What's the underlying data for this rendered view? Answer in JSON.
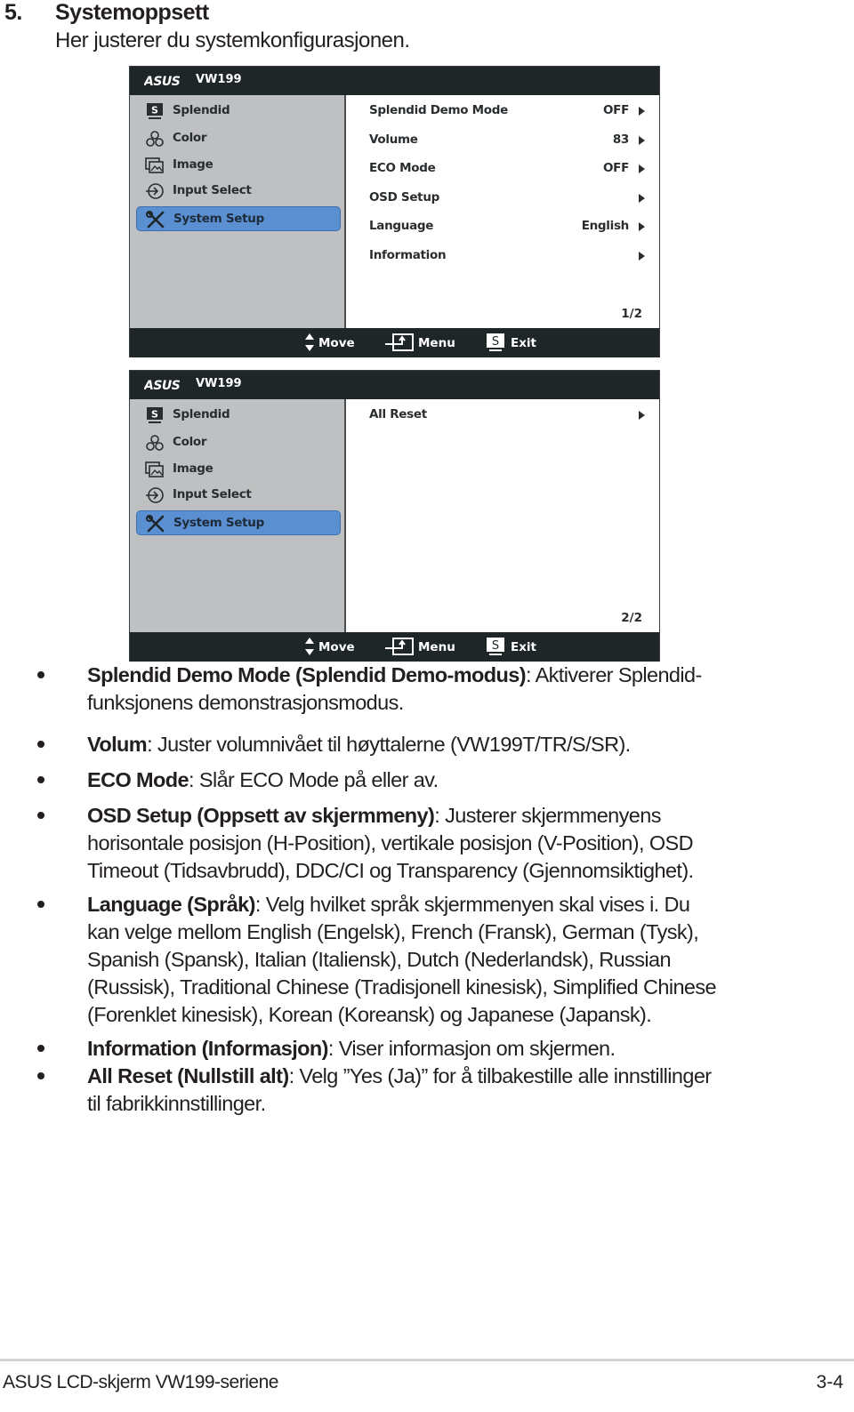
{
  "section": {
    "number": "5.",
    "title": "Systemoppsett",
    "subtitle": "Her justerer du systemkonfigurasjonen."
  },
  "osd_panels": [
    {
      "brand": "ASUS",
      "model": "VW199",
      "sidebar": [
        {
          "label": "Splendid",
          "icon": "splendid-icon",
          "active": false
        },
        {
          "label": "Color",
          "icon": "color-icon",
          "active": false
        },
        {
          "label": "Image",
          "icon": "image-icon",
          "active": false
        },
        {
          "label": "Input Select",
          "icon": "input-select-icon",
          "active": false
        },
        {
          "label": "System Setup",
          "icon": "system-setup-icon",
          "active": true
        }
      ],
      "items": [
        {
          "label": "Splendid Demo Mode",
          "value": "OFF"
        },
        {
          "label": "Volume",
          "value": "83"
        },
        {
          "label": "ECO Mode",
          "value": "OFF"
        },
        {
          "label": "OSD Setup",
          "value": ""
        },
        {
          "label": "Language",
          "value": "English"
        },
        {
          "label": "Information",
          "value": ""
        }
      ],
      "page": "1/2",
      "footer": {
        "move": "Move",
        "menu": "Menu",
        "exit": "Exit"
      }
    },
    {
      "brand": "ASUS",
      "model": "VW199",
      "sidebar": [
        {
          "label": "Splendid",
          "icon": "splendid-icon",
          "active": false
        },
        {
          "label": "Color",
          "icon": "color-icon",
          "active": false
        },
        {
          "label": "Image",
          "icon": "image-icon",
          "active": false
        },
        {
          "label": "Input Select",
          "icon": "input-select-icon",
          "active": false
        },
        {
          "label": "System Setup",
          "icon": "system-setup-icon",
          "active": true
        }
      ],
      "items": [
        {
          "label": "All Reset",
          "value": ""
        }
      ],
      "page": "2/2",
      "footer": {
        "move": "Move",
        "menu": "Menu",
        "exit": "Exit"
      }
    }
  ],
  "bullets": [
    {
      "term": "Splendid Demo Mode (Splendid Demo-modus)",
      "lines": [
        ": Aktiverer Splendid-",
        "funksjonens demonstrasjonsmodus."
      ]
    },
    {
      "term": "Volum",
      "lines": [
        ": Juster volumnivået til høyttalerne (VW199T/TR/S/SR)."
      ]
    },
    {
      "term": "ECO Mode",
      "lines": [
        ": Slår ECO Mode på eller av."
      ]
    },
    {
      "term": "OSD Setup (Oppsett av skjermmeny)",
      "lines": [
        ": Justerer skjermmenyens",
        "horisontale posisjon (H-Position), vertikale posisjon (V-Position), OSD",
        "Timeout (Tidsavbrudd), DDC/CI og Transparency (Gjennomsiktighet)."
      ]
    },
    {
      "term": "Language (Språk)",
      "lines": [
        ": Velg hvilket språk skjermmenyen skal vises i. Du",
        "kan velge mellom English (Engelsk), French (Fransk), German (Tysk),",
        "Spanish (Spansk), Italian (Italiensk), Dutch (Nederlandsk), Russian",
        "(Russisk), Traditional Chinese (Tradisjonell kinesisk), Simplified Chinese",
        "(Forenklet kinesisk), Korean (Koreansk) og Japanese (Japansk)."
      ]
    },
    {
      "term": "Information (Informasjon)",
      "lines": [
        ": Viser informasjon om skjermen."
      ]
    },
    {
      "term": "All Reset (Nullstill alt)",
      "lines": [
        ": Velg ”Yes (Ja)” for å tilbakestille alle innstillinger",
        "til fabrikkinnstillinger."
      ]
    }
  ],
  "footer": {
    "title": "ASUS LCD-skjerm VW199-seriene",
    "page": "3-4"
  },
  "colors": {
    "osd_bar": "#1e2628",
    "osd_sidebar": "#bfc0c1",
    "osd_active": "#5a8fd2",
    "text": "#231f20"
  }
}
